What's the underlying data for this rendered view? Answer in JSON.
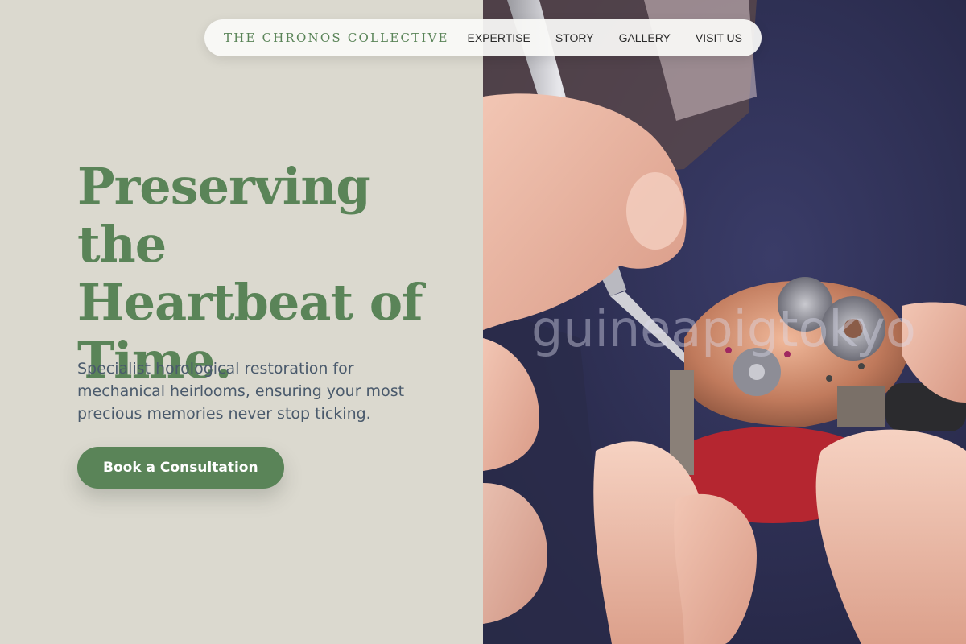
{
  "nav": {
    "brand": "THE CHRONOS COLLECTIVE",
    "links": [
      {
        "label": "EXPERTISE"
      },
      {
        "label": "STORY"
      },
      {
        "label": "GALLERY"
      },
      {
        "label": "VISIT US"
      }
    ]
  },
  "hero": {
    "headline": "Preserving the Heartbeat of Time.",
    "subtitle": "Specialist horological restoration for mechanical heirlooms, ensuring your most precious memories never stop ticking.",
    "cta_label": "Book a Consultation"
  },
  "photo": {
    "watermark": "guineapigtokyo"
  },
  "colors": {
    "accent": "#5a8458",
    "background": "#dbd9cf",
    "body_text": "#4a5a6c"
  }
}
